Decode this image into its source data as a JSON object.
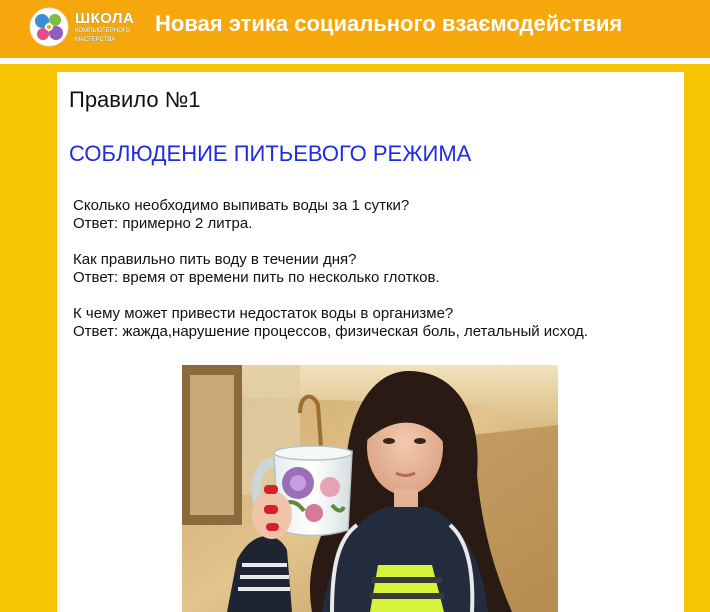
{
  "header": {
    "logo_title": "ШКОЛА",
    "logo_subtitle_1": "КОМПЬЮТЕРНОГО",
    "logo_subtitle_2": "МАСТЕРСТВА",
    "site_title": "Новая этика социального взаємодействия"
  },
  "article": {
    "rule_title": "Правило №1",
    "rule_heading": "СОБЛЮДЕНИЕ ПИТЬЕВОГО РЕЖИМА",
    "qa": [
      {
        "question": "Сколько необходимо выпивать воды за 1 сутки?",
        "answer": "Ответ: примерно 2 литра."
      },
      {
        "question": "Как правильно пить воду в течении дня?",
        "answer": "Ответ: время от времени пить по несколько глотков."
      },
      {
        "question": "К чему может привести недостаток воды в организме?",
        "answer": "Ответ: жажда,нарушение процессов, физическая боль, летальный исход."
      }
    ]
  },
  "colors": {
    "header_bg": "#F5A70B",
    "page_bg": "#F6C400",
    "heading_blue": "#1F2BE0"
  }
}
